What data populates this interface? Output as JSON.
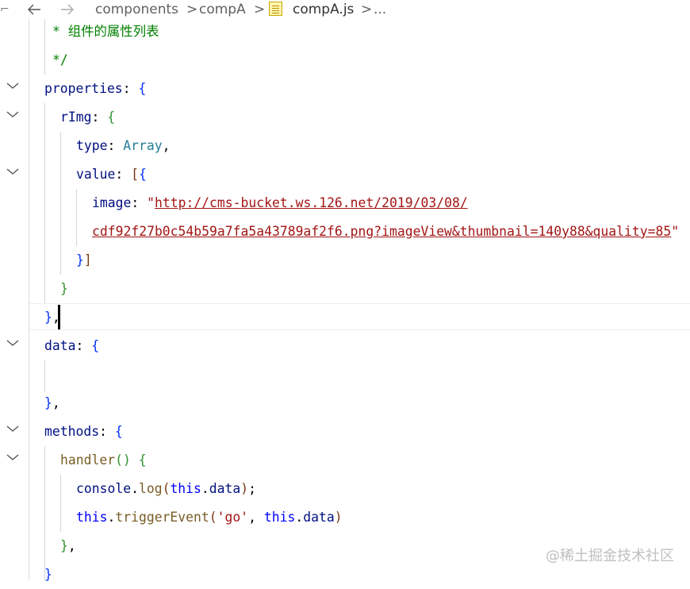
{
  "breadcrumb": {
    "path": [
      "components",
      "compA",
      "compA.js",
      "..."
    ],
    "separator": ">"
  },
  "editor": {
    "lines": {
      "l1": "* 组件的属性列表",
      "l2": "*/",
      "l3_key": "properties",
      "l4_key": "rImg",
      "l5_key": "type",
      "l5_val": "Array",
      "l6_key": "value",
      "l7_key": "image",
      "l7_url": "http://cms-bucket.ws.126.net/2019/03/08/",
      "l8_url": "cdf92f27b0c54b59a7fa5a43789af2f6.png?imageView&thumbnail=140y88&quality=85",
      "l13_key": "data",
      "l16_key": "methods",
      "l17_fn": "handler",
      "l18_obj": "console",
      "l18_fn": "log",
      "l18_this": "this",
      "l18_prop": "data",
      "l19_this": "this",
      "l19_fn": "triggerEvent",
      "l19_str": "'go'",
      "l19_this2": "this",
      "l19_prop": "data"
    }
  },
  "watermark": "@稀土掘金技术社区",
  "colors": {
    "comment": "#008000",
    "property": "#001080",
    "type": "#267f99",
    "string": "#a31515",
    "keyword": "#0000ff",
    "function": "#795e26"
  },
  "icons": [
    "back-arrow-icon",
    "forward-arrow-icon",
    "chevron-right-icon",
    "js-file-icon",
    "chevron-down-icon"
  ]
}
